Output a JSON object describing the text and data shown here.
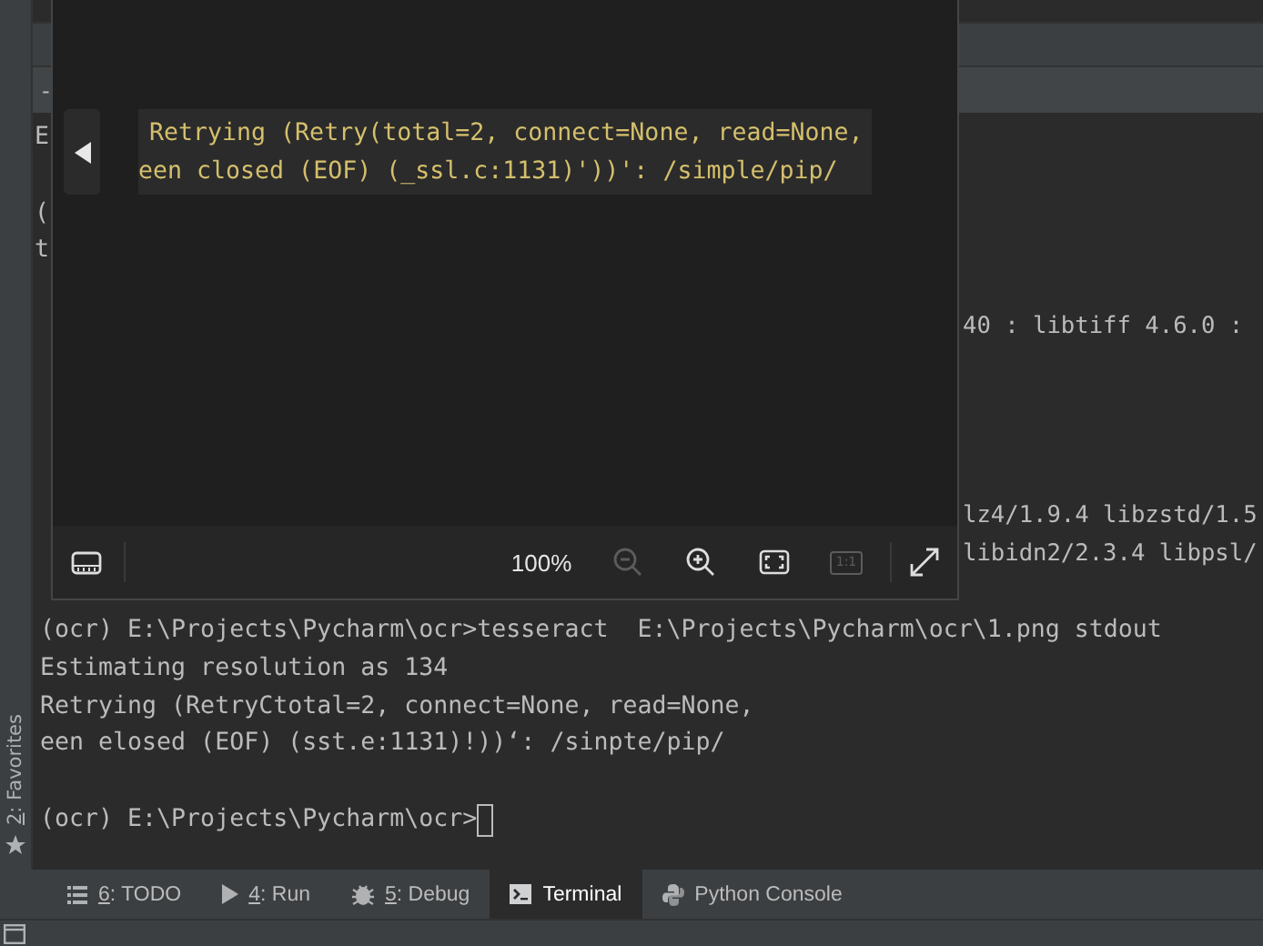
{
  "top_bars": {
    "tab_text": "-"
  },
  "side_strip": {
    "mnemonic": "2",
    "label": ": Favorites"
  },
  "terminal": {
    "covered_left": [
      "E",
      "(",
      "t"
    ],
    "covered_right": [
      "40 : libtiff 4.6.0 :",
      "lz4/1.9.4 libzstd/1.5",
      "libidn2/2.3.4 libpsl/"
    ],
    "lines": [
      "(ocr) E:\\Projects\\Pycharm\\ocr>tesseract  E:\\Projects\\Pycharm\\ocr\\1.png stdout",
      "Estimating resolution as 134",
      "Retrying (RetryCtotal=2, connect=None, read=None,",
      "een elosed (EOF) (sst.e:1131)!))‘: /sinpte/pip/"
    ],
    "prompt": "(ocr) E:\\Projects\\Pycharm\\ocr>"
  },
  "image_viewer": {
    "image_lines": [
      "Retrying (Retry(total=2, connect=None, read=None,",
      "een closed (EOF) (_ssl.c:1131)'))': /simple/pip/"
    ],
    "zoom": "100%",
    "zoom_out_disabled": true,
    "actual_size_label": "1:1",
    "actual_size_disabled": true
  },
  "tool_tabs": [
    {
      "kind": "todo",
      "mnemonic": "6",
      "label": ": TODO",
      "selected": false
    },
    {
      "kind": "run",
      "mnemonic": "4",
      "label": ": Run",
      "selected": false
    },
    {
      "kind": "debug",
      "mnemonic": "5",
      "label": ": Debug",
      "selected": false
    },
    {
      "kind": "terminal",
      "label": "Terminal",
      "selected": true
    },
    {
      "kind": "python",
      "label": "Python Console",
      "selected": false
    }
  ]
}
